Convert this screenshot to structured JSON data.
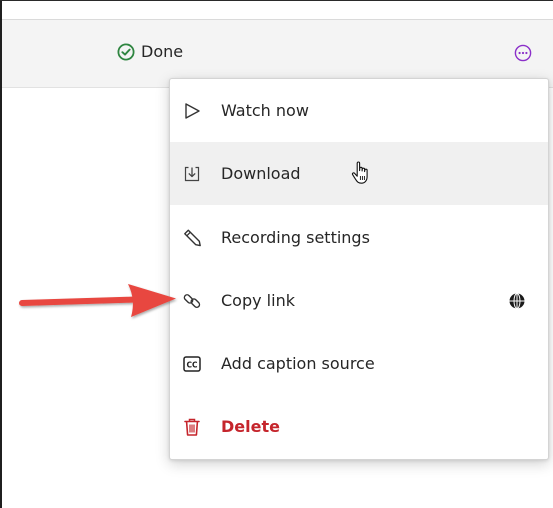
{
  "row": {
    "status_label": "Done",
    "status_icon": "check-circle-icon",
    "status_color": "#2e8540",
    "more_icon": "more-horizontal-icon",
    "more_color": "#8b2fc9"
  },
  "menu": {
    "items": [
      {
        "label": "Watch now",
        "icon": "play-icon"
      },
      {
        "label": "Download",
        "icon": "download-icon"
      },
      {
        "label": "Recording settings",
        "icon": "pencil-icon"
      },
      {
        "label": "Copy link",
        "icon": "link-icon"
      },
      {
        "label": "Add caption source",
        "icon": "closed-caption-icon"
      },
      {
        "label": "Delete",
        "icon": "trash-icon"
      }
    ],
    "hovered_item": "Download",
    "danger_color": "#c5252c"
  },
  "annotation": {
    "arrow_color": "#e8473f",
    "points_to": "Copy link"
  }
}
